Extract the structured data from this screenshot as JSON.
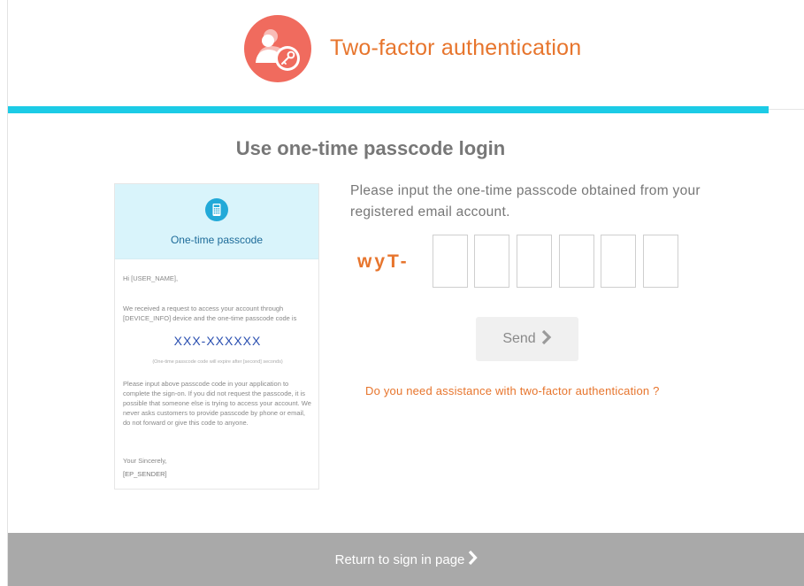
{
  "header": {
    "title": "Two-factor authentication",
    "logo_icon": "user-key-icon"
  },
  "main": {
    "title": "Use one-time passcode login",
    "instructions": "Please input the one-time passcode obtained from your registered email account.",
    "prefix": "wyT-",
    "otp_digits": [
      "",
      "",
      "",
      "",
      "",
      ""
    ],
    "send_label": "Send",
    "help_link": "Do you need assistance with two-factor authentication ?"
  },
  "email_preview": {
    "icon": "calculator-icon",
    "heading": "One-time passcode",
    "greeting": "Hi [USER_NAME],",
    "paragraph1": "We received a request to access your account through [DEVICE_INFO] device and the one-time passcode code is",
    "code": "XXX-XXXXXX",
    "code_note": "(One-time passcode code will expire after [second] seconds)",
    "paragraph2": "Please input above passcode code in your application to complete the sign-on. If you did not request the passcode, it is possible that someone else is trying to access your account. We never asks customers to provide passcode by phone or email, do not forward or give this code to anyone.",
    "closing": "Your Sincerely,",
    "sender": "[EP_SENDER]"
  },
  "footer": {
    "return_label": "Return to sign in page"
  },
  "colors": {
    "accent_orange": "#e7752d",
    "bar_cyan": "#1ccbe6",
    "logo_red": "#f06b5e",
    "footer_gray": "#a9a9a9"
  }
}
